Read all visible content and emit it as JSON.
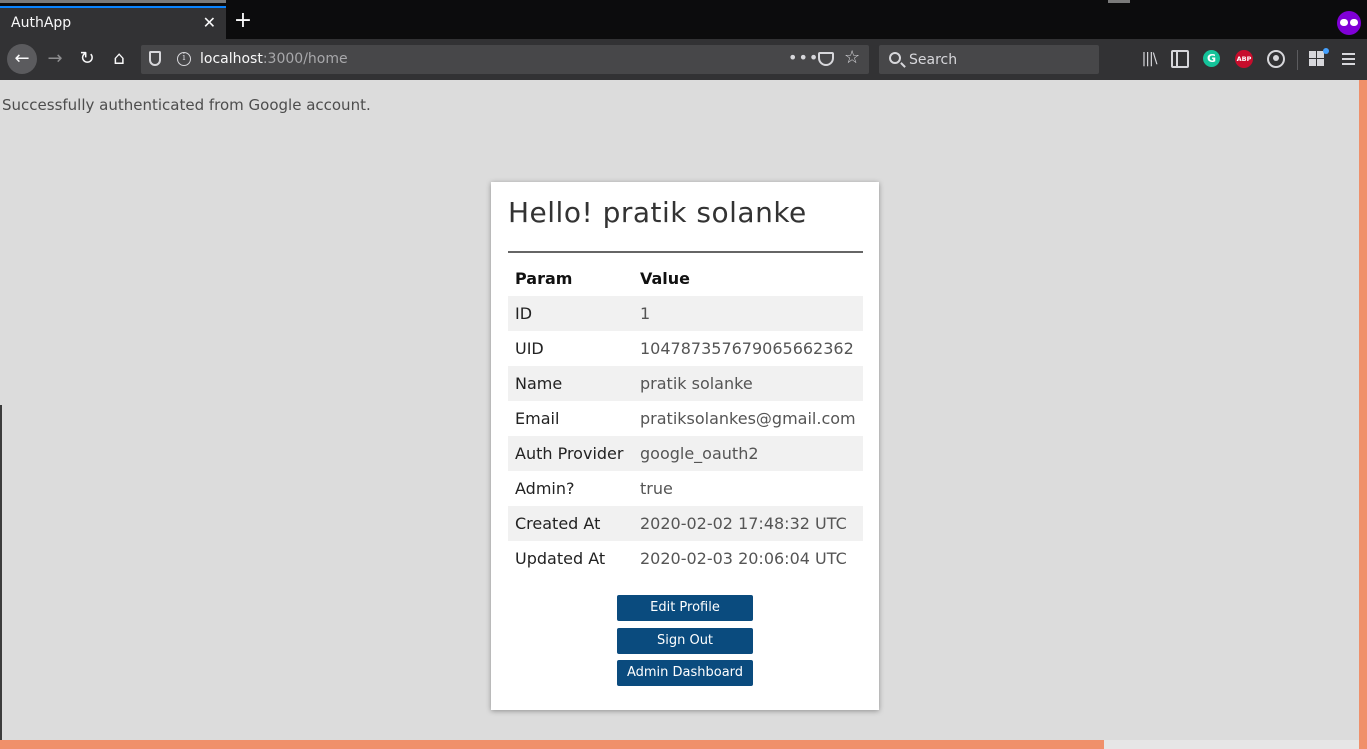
{
  "browser": {
    "tab_title": "AuthApp",
    "tab_close_glyph": "✕",
    "new_tab_glyph": "+",
    "url_host": "localhost",
    "url_path": ":3000/home",
    "search_placeholder": "Search",
    "more_glyph": "•••",
    "star_glyph": "☆",
    "abp_label": "ABP",
    "grammarly_label": "G",
    "icons": [
      "back-icon",
      "forward-icon",
      "reload-icon",
      "home-icon",
      "shield-icon",
      "info-icon",
      "page-actions-icon",
      "pocket-icon",
      "bookmark-star-icon",
      "search-icon",
      "library-icon",
      "sidebar-icon",
      "grammarly-icon",
      "adblock-icon",
      "account-icon",
      "extensions-icon",
      "menu-icon",
      "private-mask-icon"
    ]
  },
  "page": {
    "flash": "Successfully authenticated from Google account.",
    "heading": "Hello! pratik solanke",
    "table": {
      "headers": [
        "Param",
        "Value"
      ],
      "rows": [
        {
          "param": "ID",
          "value": "1"
        },
        {
          "param": "UID",
          "value": "104787357679065662362"
        },
        {
          "param": "Name",
          "value": "pratik solanke"
        },
        {
          "param": "Email",
          "value": "pratiksolankes@gmail.com"
        },
        {
          "param": "Auth Provider",
          "value": "google_oauth2"
        },
        {
          "param": "Admin?",
          "value": "true"
        },
        {
          "param": "Created At",
          "value": "2020-02-02 17:48:32 UTC"
        },
        {
          "param": "Updated At",
          "value": "2020-02-03 20:06:04 UTC"
        }
      ]
    },
    "buttons": {
      "edit_profile": "Edit Profile",
      "sign_out": "Sign Out",
      "admin_dashboard": "Admin Dashboard"
    }
  },
  "colors": {
    "accent_button": "#0a4b7e",
    "page_background": "#dcdcdc",
    "border_accent": "#f0906a"
  }
}
